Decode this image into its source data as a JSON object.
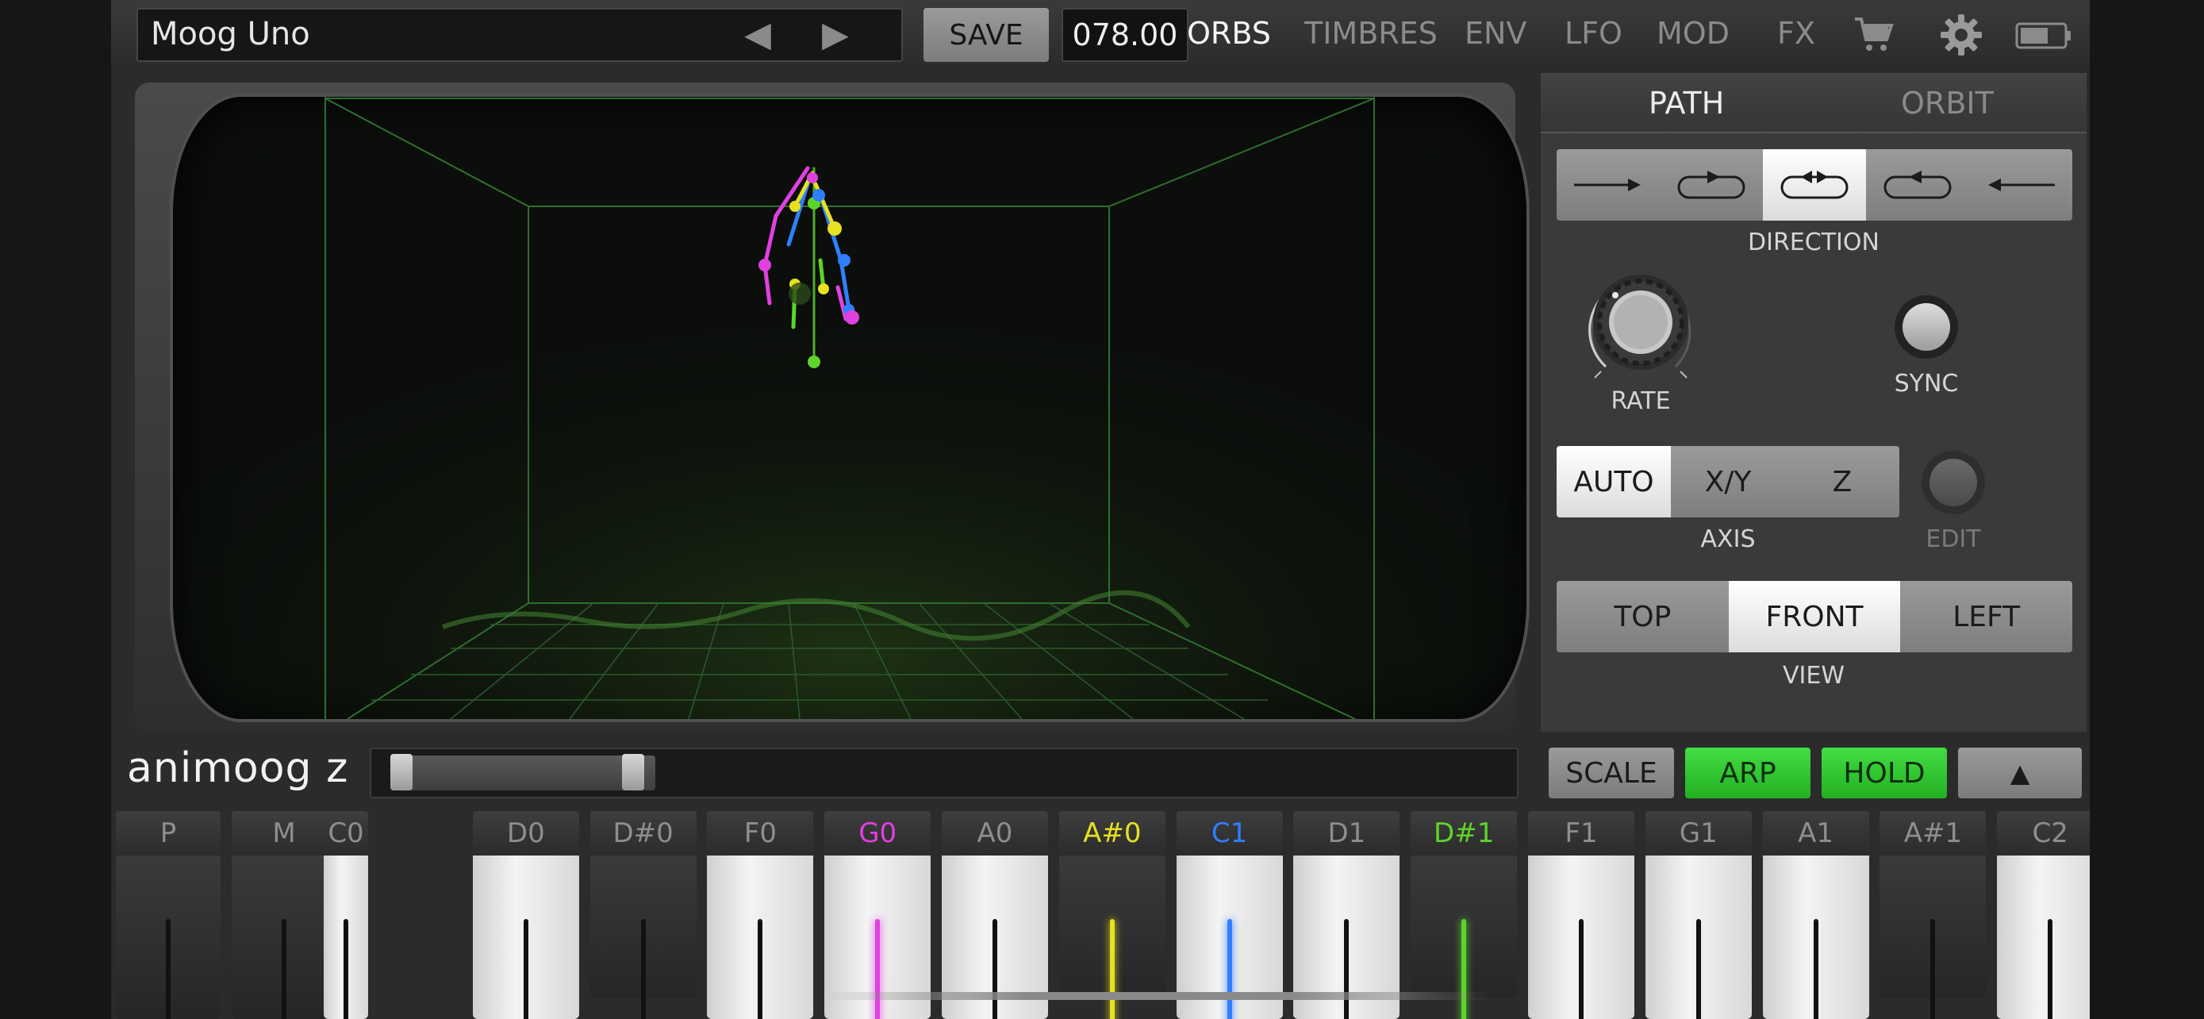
{
  "topbar": {
    "preset_name": "Moog Uno",
    "prev_icon": "◀",
    "next_icon": "▶",
    "save_label": "SAVE",
    "tempo": "078.00",
    "tabs": [
      "ORBS",
      "TIMBRES",
      "ENV",
      "LFO",
      "MOD",
      "FX"
    ],
    "active_tab": "ORBS",
    "icons": [
      "cart-icon",
      "gear-icon",
      "battery-icon"
    ]
  },
  "panel": {
    "tabs": [
      "PATH",
      "ORBIT"
    ],
    "active_tab": "PATH",
    "direction_label": "DIRECTION",
    "direction_options": [
      "forward",
      "forward-loop",
      "bounce",
      "reverse-loop",
      "reverse"
    ],
    "direction_selected": "bounce",
    "rate_label": "RATE",
    "sync_label": "SYNC",
    "axis_label": "AXIS",
    "axis_options": [
      "AUTO",
      "X/Y",
      "Z"
    ],
    "axis_selected": "AUTO",
    "edit_label": "EDIT",
    "view_label": "VIEW",
    "view_options": [
      "TOP",
      "FRONT",
      "LEFT"
    ],
    "view_selected": "FRONT"
  },
  "bottom": {
    "logo": "animoog z",
    "scale_label": "SCALE",
    "arp_label": "ARP",
    "hold_label": "HOLD",
    "up_icon": "▲"
  },
  "keyboard": {
    "mod_keys": [
      "P",
      "M"
    ],
    "keys": [
      {
        "label": "C0",
        "type": "white",
        "color": ""
      },
      {
        "label": "D0",
        "type": "white",
        "color": ""
      },
      {
        "label": "D#0",
        "type": "black",
        "color": ""
      },
      {
        "label": "F0",
        "type": "white",
        "color": ""
      },
      {
        "label": "G0",
        "type": "white",
        "color": "#e040e0"
      },
      {
        "label": "A0",
        "type": "white",
        "color": ""
      },
      {
        "label": "A#0",
        "type": "black",
        "color": "#e8e020"
      },
      {
        "label": "C1",
        "type": "white",
        "color": "#2f7fff"
      },
      {
        "label": "D1",
        "type": "white",
        "color": ""
      },
      {
        "label": "D#1",
        "type": "black",
        "color": "#5ed42a"
      },
      {
        "label": "F1",
        "type": "white",
        "color": ""
      },
      {
        "label": "G1",
        "type": "white",
        "color": ""
      },
      {
        "label": "A1",
        "type": "white",
        "color": ""
      },
      {
        "label": "A#1",
        "type": "black",
        "color": ""
      },
      {
        "label": "C2",
        "type": "white",
        "color": ""
      }
    ]
  },
  "colors": {
    "accent_green": "#2fc42f",
    "orb_magenta": "#e040e0",
    "orb_yellow": "#e8e020",
    "orb_blue": "#2f7fff",
    "orb_green": "#5ed42a"
  }
}
